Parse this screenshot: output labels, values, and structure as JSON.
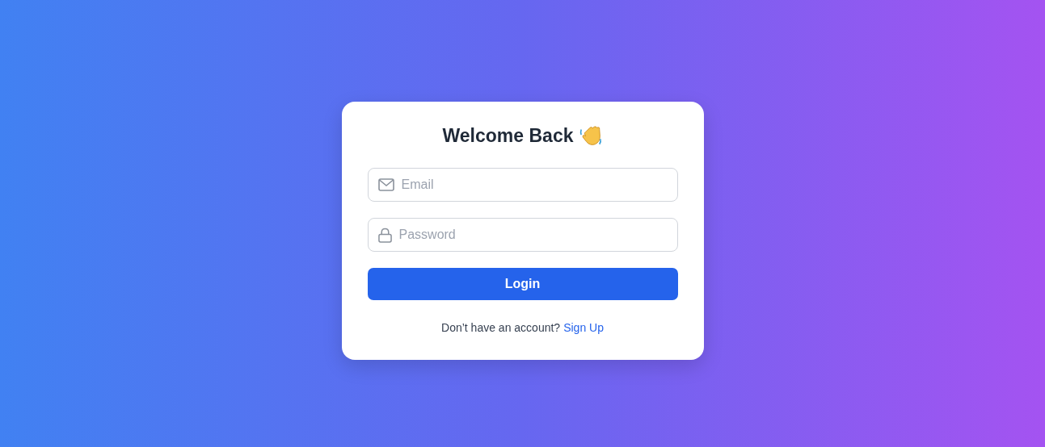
{
  "card": {
    "title": "Welcome Back",
    "fields": [
      {
        "kind": "email",
        "placeholder": "Email"
      },
      {
        "kind": "password",
        "placeholder": "Password"
      }
    ],
    "button": "Login",
    "footer": {
      "text": "Don’t have an account?",
      "link": "Sign Up"
    }
  }
}
